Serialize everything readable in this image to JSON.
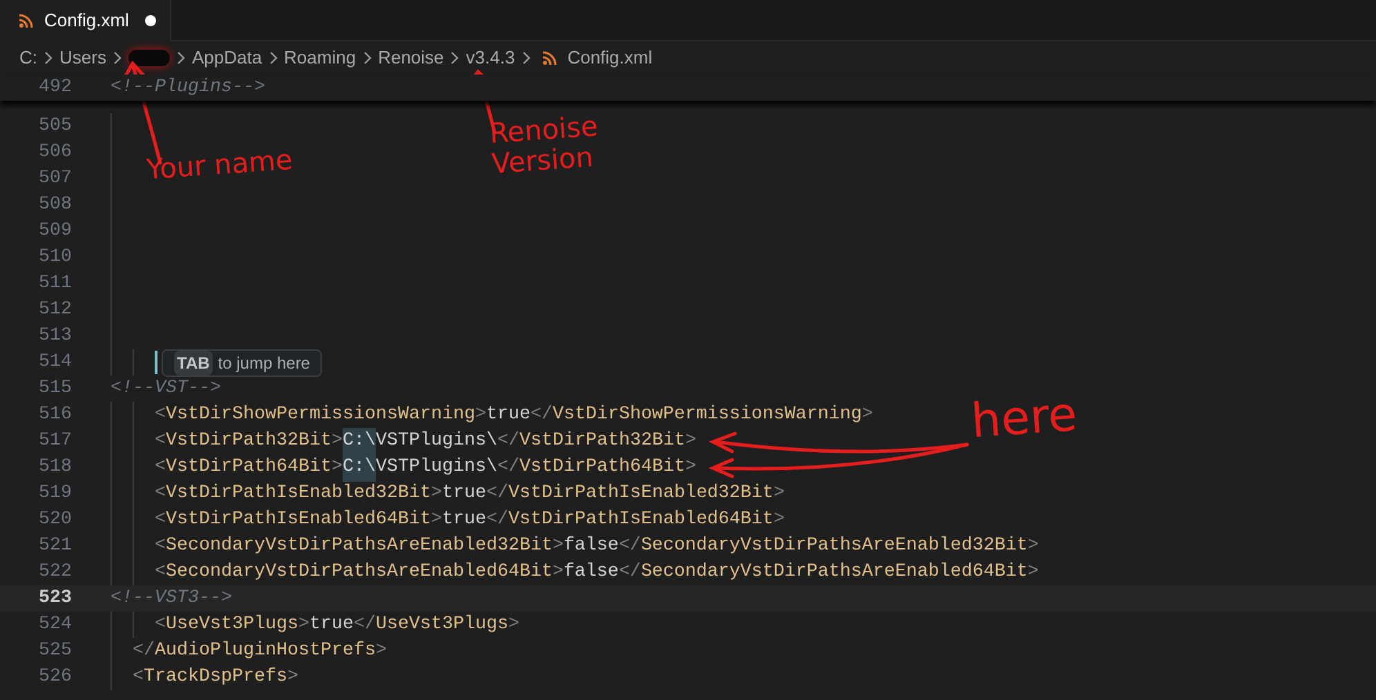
{
  "tabs": [
    {
      "label": "Config.xml",
      "selected": true,
      "modified": true
    }
  ],
  "breadcrumb": [
    {
      "kind": "text",
      "label": "C:"
    },
    {
      "kind": "text",
      "label": "Users"
    },
    {
      "kind": "redacted"
    },
    {
      "kind": "text",
      "label": "AppData"
    },
    {
      "kind": "text",
      "label": "Roaming"
    },
    {
      "kind": "text",
      "label": "Renoise"
    },
    {
      "kind": "text",
      "label": "v3.4.3"
    },
    {
      "kind": "file",
      "label": "Config.xml"
    }
  ],
  "sticky_line": {
    "number": "492",
    "tokens": [
      {
        "kind": "comment",
        "text": "<!--Plugins-->"
      }
    ]
  },
  "lines": [
    {
      "number": "505",
      "kind": "blank",
      "current": false
    },
    {
      "number": "506",
      "kind": "blank",
      "current": false
    },
    {
      "number": "507",
      "kind": "blank",
      "current": false
    },
    {
      "number": "508",
      "kind": "blank",
      "current": false
    },
    {
      "number": "509",
      "kind": "blank",
      "current": false
    },
    {
      "number": "510",
      "kind": "blank",
      "current": false
    },
    {
      "number": "511",
      "kind": "blank",
      "current": false
    },
    {
      "number": "512",
      "kind": "blank",
      "current": false
    },
    {
      "number": "513",
      "kind": "blank",
      "current": false
    },
    {
      "number": "514",
      "kind": "inner",
      "current": false,
      "hint": {
        "key": "TAB",
        "text": "to jump here"
      }
    },
    {
      "number": "515",
      "kind": "top",
      "current": false,
      "tokens": [
        {
          "kind": "comment",
          "text": "<!--VST-->"
        }
      ]
    },
    {
      "number": "516",
      "kind": "inner",
      "current": false,
      "tokens": [
        {
          "kind": "punct",
          "text": "<"
        },
        {
          "kind": "tag",
          "text": "VstDirShowPermissionsWarning"
        },
        {
          "kind": "punct",
          "text": ">"
        },
        {
          "kind": "text",
          "text": "true"
        },
        {
          "kind": "punct",
          "text": "</"
        },
        {
          "kind": "tag",
          "text": "VstDirShowPermissionsWarning"
        },
        {
          "kind": "punct",
          "text": ">"
        }
      ]
    },
    {
      "number": "517",
      "kind": "inner",
      "current": false,
      "tokens": [
        {
          "kind": "punct",
          "text": "<"
        },
        {
          "kind": "tag",
          "text": "VstDirPath32Bit"
        },
        {
          "kind": "punct",
          "text": ">"
        },
        {
          "kind": "match",
          "text": "C:\\"
        },
        {
          "kind": "text",
          "text": "VSTPlugins\\"
        },
        {
          "kind": "punct",
          "text": "</"
        },
        {
          "kind": "tag",
          "text": "VstDirPath32Bit"
        },
        {
          "kind": "punct",
          "text": ">"
        }
      ]
    },
    {
      "number": "518",
      "kind": "inner",
      "current": false,
      "tokens": [
        {
          "kind": "punct",
          "text": "<"
        },
        {
          "kind": "tag",
          "text": "VstDirPath64Bit"
        },
        {
          "kind": "punct",
          "text": ">"
        },
        {
          "kind": "match",
          "text": "C:\\"
        },
        {
          "kind": "text",
          "text": "VSTPlugins\\"
        },
        {
          "kind": "punct",
          "text": "</"
        },
        {
          "kind": "tag",
          "text": "VstDirPath64Bit"
        },
        {
          "kind": "punct",
          "text": ">"
        }
      ]
    },
    {
      "number": "519",
      "kind": "inner",
      "current": false,
      "tokens": [
        {
          "kind": "punct",
          "text": "<"
        },
        {
          "kind": "tag",
          "text": "VstDirPathIsEnabled32Bit"
        },
        {
          "kind": "punct",
          "text": ">"
        },
        {
          "kind": "text",
          "text": "true"
        },
        {
          "kind": "punct",
          "text": "</"
        },
        {
          "kind": "tag",
          "text": "VstDirPathIsEnabled32Bit"
        },
        {
          "kind": "punct",
          "text": ">"
        }
      ]
    },
    {
      "number": "520",
      "kind": "inner",
      "current": false,
      "tokens": [
        {
          "kind": "punct",
          "text": "<"
        },
        {
          "kind": "tag",
          "text": "VstDirPathIsEnabled64Bit"
        },
        {
          "kind": "punct",
          "text": ">"
        },
        {
          "kind": "text",
          "text": "true"
        },
        {
          "kind": "punct",
          "text": "</"
        },
        {
          "kind": "tag",
          "text": "VstDirPathIsEnabled64Bit"
        },
        {
          "kind": "punct",
          "text": ">"
        }
      ]
    },
    {
      "number": "521",
      "kind": "inner",
      "current": false,
      "tokens": [
        {
          "kind": "punct",
          "text": "<"
        },
        {
          "kind": "tag",
          "text": "SecondaryVstDirPathsAreEnabled32Bit"
        },
        {
          "kind": "punct",
          "text": ">"
        },
        {
          "kind": "text",
          "text": "false"
        },
        {
          "kind": "punct",
          "text": "</"
        },
        {
          "kind": "tag",
          "text": "SecondaryVstDirPathsAreEnabled32Bit"
        },
        {
          "kind": "punct",
          "text": ">"
        }
      ]
    },
    {
      "number": "522",
      "kind": "inner",
      "current": false,
      "tokens": [
        {
          "kind": "punct",
          "text": "<"
        },
        {
          "kind": "tag",
          "text": "SecondaryVstDirPathsAreEnabled64Bit"
        },
        {
          "kind": "punct",
          "text": ">"
        },
        {
          "kind": "text",
          "text": "false"
        },
        {
          "kind": "punct",
          "text": "</"
        },
        {
          "kind": "tag",
          "text": "SecondaryVstDirPathsAreEnabled64Bit"
        },
        {
          "kind": "punct",
          "text": ">"
        }
      ]
    },
    {
      "number": "523",
      "kind": "top",
      "current": true,
      "tokens": [
        {
          "kind": "comment",
          "text": "<!--VST3-->"
        }
      ]
    },
    {
      "number": "524",
      "kind": "inner",
      "current": false,
      "tokens": [
        {
          "kind": "punct",
          "text": "<"
        },
        {
          "kind": "tag",
          "text": "UseVst3Plugs"
        },
        {
          "kind": "punct",
          "text": ">"
        },
        {
          "kind": "text",
          "text": "true"
        },
        {
          "kind": "punct",
          "text": "</"
        },
        {
          "kind": "tag",
          "text": "UseVst3Plugs"
        },
        {
          "kind": "punct",
          "text": ">"
        }
      ]
    },
    {
      "number": "525",
      "kind": "outer",
      "current": false,
      "tokens": [
        {
          "kind": "punct",
          "text": "</"
        },
        {
          "kind": "tag",
          "text": "AudioPluginHostPrefs"
        },
        {
          "kind": "punct",
          "text": ">"
        }
      ]
    },
    {
      "number": "526",
      "kind": "outer",
      "current": false,
      "tokens": [
        {
          "kind": "punct",
          "text": "<"
        },
        {
          "kind": "tag",
          "text": "TrackDspPrefs"
        },
        {
          "kind": "punct",
          "text": ">"
        }
      ]
    }
  ],
  "annotations": [
    {
      "kind": "name",
      "text": "Your name"
    },
    {
      "kind": "version",
      "text": "Renoise Version"
    },
    {
      "kind": "here",
      "text": "here"
    }
  ]
}
